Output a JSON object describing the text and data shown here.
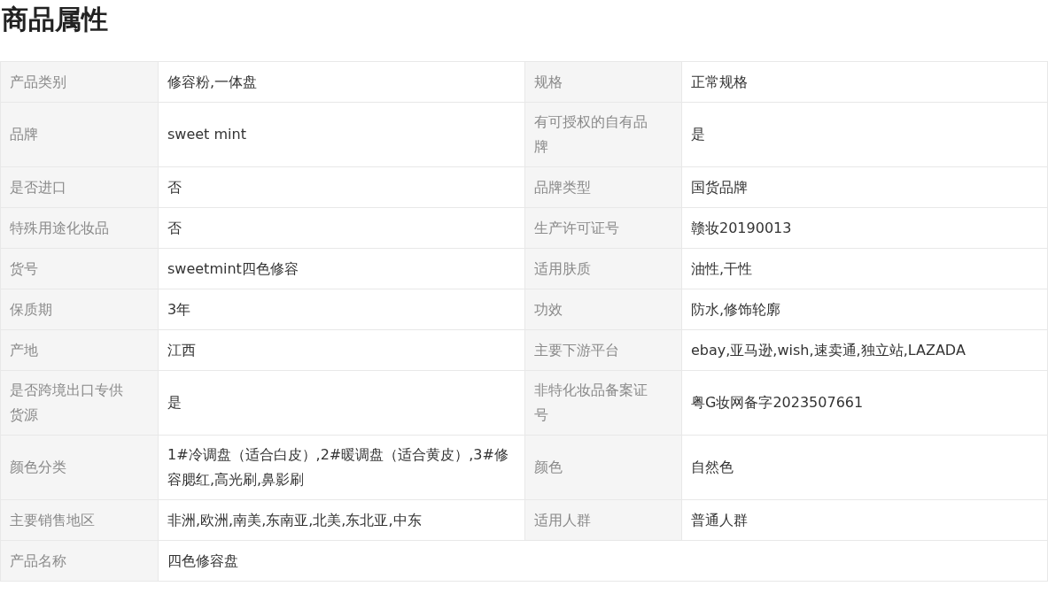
{
  "title": "商品属性",
  "rows": [
    [
      {
        "label": "产品类别",
        "value": "修容粉,一体盘"
      },
      {
        "label": "规格",
        "value": "正常规格"
      }
    ],
    [
      {
        "label": "品牌",
        "value": "sweet mint"
      },
      {
        "label": "有可授权的自有品牌",
        "value": "是"
      }
    ],
    [
      {
        "label": "是否进口",
        "value": "否"
      },
      {
        "label": "品牌类型",
        "value": "国货品牌"
      }
    ],
    [
      {
        "label": "特殊用途化妆品",
        "value": "否"
      },
      {
        "label": "生产许可证号",
        "value": "赣妆20190013"
      }
    ],
    [
      {
        "label": "货号",
        "value": "sweetmint四色修容"
      },
      {
        "label": "适用肤质",
        "value": "油性,干性"
      }
    ],
    [
      {
        "label": "保质期",
        "value": "3年"
      },
      {
        "label": "功效",
        "value": "防水,修饰轮廓"
      }
    ],
    [
      {
        "label": "产地",
        "value": "江西"
      },
      {
        "label": "主要下游平台",
        "value": "ebay,亚马逊,wish,速卖通,独立站,LAZADA"
      }
    ],
    [
      {
        "label": "是否跨境出口专供货源",
        "value": "是"
      },
      {
        "label": "非特化妆品备案证号",
        "value": "粤G妆网备字2023507661"
      }
    ],
    [
      {
        "label": "颜色分类",
        "value": "1#冷调盘（适合白皮）,2#暖调盘（适合黄皮）,3#修容腮红,高光刷,鼻影刷"
      },
      {
        "label": "颜色",
        "value": "自然色"
      }
    ],
    [
      {
        "label": "主要销售地区",
        "value": "非洲,欧洲,南美,东南亚,北美,东北亚,中东"
      },
      {
        "label": "适用人群",
        "value": "普通人群"
      }
    ],
    [
      {
        "label": "产品名称",
        "value": "四色修容盘"
      }
    ]
  ]
}
